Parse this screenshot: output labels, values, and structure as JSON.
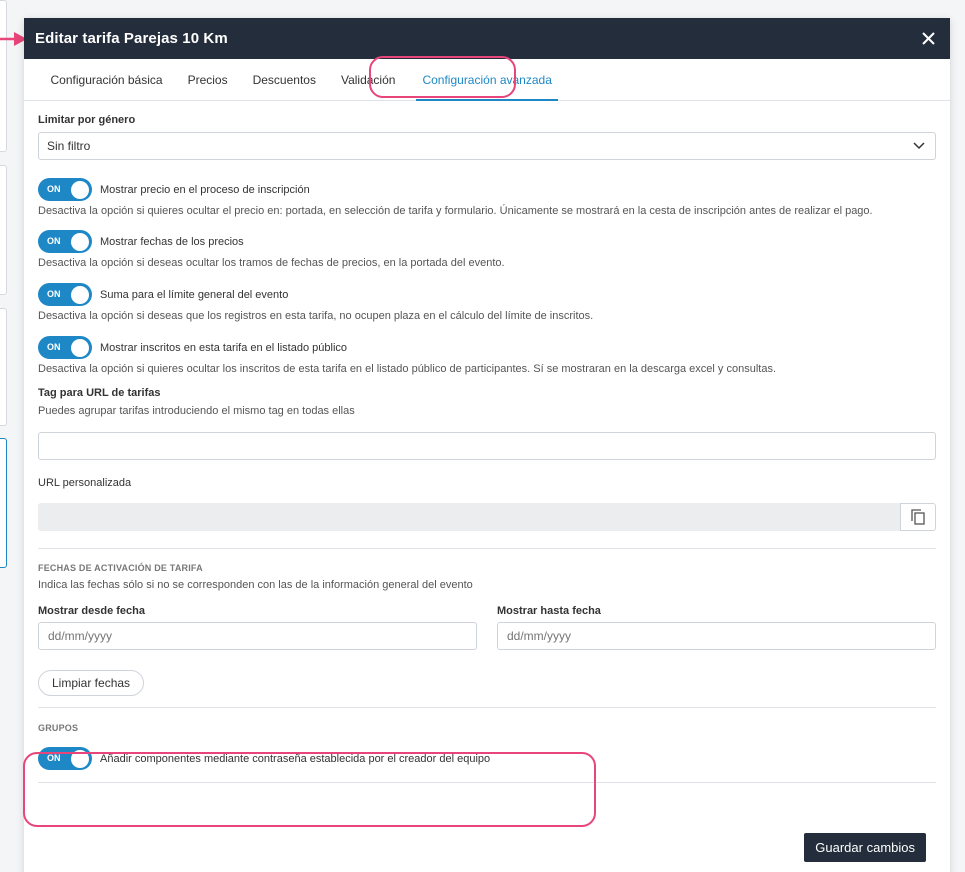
{
  "modal": {
    "title": "Editar tarifa Parejas 10 Km"
  },
  "tabs": [
    {
      "label": "Configuración básica",
      "active": false
    },
    {
      "label": "Precios",
      "active": false
    },
    {
      "label": "Descuentos",
      "active": false
    },
    {
      "label": "Validación",
      "active": false
    },
    {
      "label": "Configuración avanzada",
      "active": true
    }
  ],
  "gender": {
    "label": "Limitar por género",
    "value": "Sin filtro"
  },
  "toggles": [
    {
      "state": "ON",
      "label": "Mostrar precio en el proceso de inscripción",
      "hint": "Desactiva la opción si quieres ocultar el precio en: portada, en selección de tarifa y formulario. Únicamente se mostrará en la cesta de inscripción antes de realizar el pago."
    },
    {
      "state": "ON",
      "label": "Mostrar fechas de los precios",
      "hint": "Desactiva la opción si deseas ocultar los tramos de fechas de precios, en la portada del evento."
    },
    {
      "state": "ON",
      "label": "Suma para el límite general del evento",
      "hint": "Desactiva la opción si deseas que los registros en esta tarifa, no ocupen plaza en el cálculo del límite de inscritos."
    },
    {
      "state": "ON",
      "label": "Mostrar inscritos en esta tarifa en el listado público",
      "hint": "Desactiva la opción si quieres ocultar los inscritos de esta tarifa en el listado público de participantes. Sí se mostraran en la descarga excel y consultas."
    }
  ],
  "tag": {
    "label": "Tag para URL de tarifas",
    "hint": "Puedes agrupar tarifas introduciendo el mismo tag en todas ellas",
    "value": ""
  },
  "url": {
    "label": "URL personalizada",
    "value": ""
  },
  "activation": {
    "heading": "FECHAS DE ACTIVACIÓN DE TARIFA",
    "hint": "Indica las fechas sólo si no se corresponden con las de la información general del evento",
    "from_label": "Mostrar desde fecha",
    "from_placeholder": "dd/mm/yyyy",
    "to_label": "Mostrar hasta fecha",
    "to_placeholder": "dd/mm/yyyy",
    "clear_label": "Limpiar fechas"
  },
  "groups": {
    "heading": "GRUPOS",
    "toggle_state": "ON",
    "toggle_label": "Añadir componentes mediante contraseña establecida por el creador del equipo"
  },
  "footer": {
    "save_label": "Guardar cambios"
  },
  "colors": {
    "header_bg": "#232d3b",
    "accent": "#1e88c7",
    "highlight": "#e8457a"
  }
}
